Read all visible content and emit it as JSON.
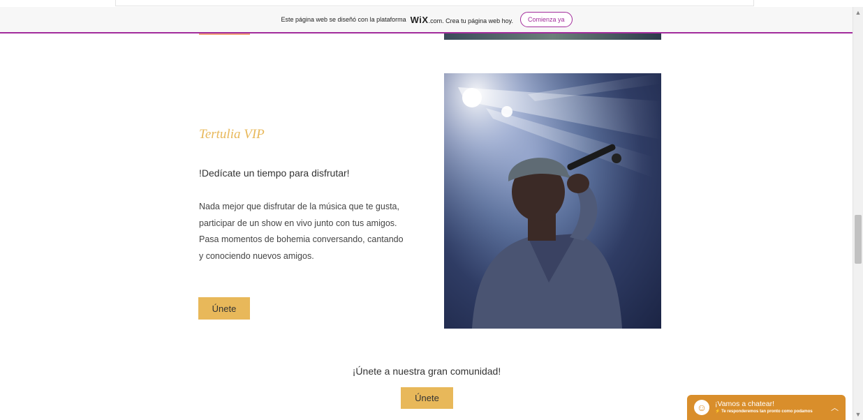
{
  "banner": {
    "text_before": "Este página web se diseñó con la plataforma",
    "brand": "WiX",
    "text_after": ".com. Crea tu página web hoy.",
    "cta_label": "Comienza ya"
  },
  "section": {
    "title": "Tertulia VIP",
    "subtitle": "!Dedícate un tiempo para disfrutar!",
    "body": "Nada mejor que disfrutar de la música que te gusta, participar de un show en vivo junto con tus amigos.  Pasa momentos de bohemia conversando, cantando y conociendo nuevos amigos.",
    "button_label": "Únete"
  },
  "community": {
    "text": "¡Únete a nuestra gran comunidad!",
    "button_label": "Únete"
  },
  "chat": {
    "title": "¡Vamos a chatear!",
    "subtitle": "Te responderemos tan pronto como podamos",
    "avatar_icon": "smile-icon",
    "toggle_icon": "chevron-up-icon"
  },
  "colors": {
    "accent_gold": "#e8b85a",
    "wix_purple": "#a22b9b",
    "chat_orange": "#d98e2b"
  }
}
